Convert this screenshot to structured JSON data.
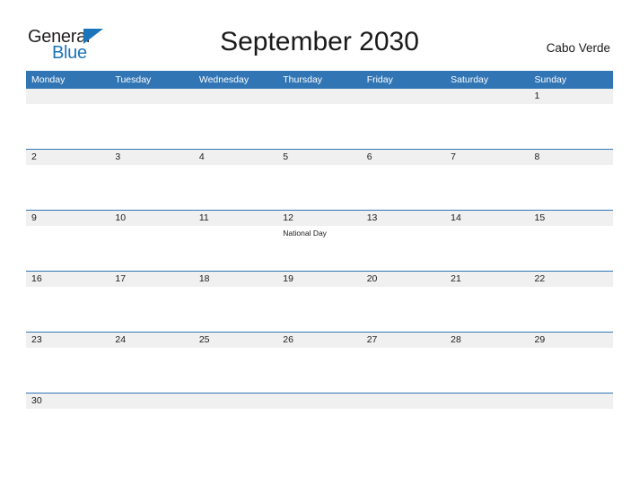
{
  "header": {
    "logo": {
      "primary_text": "General",
      "secondary_text": "Blue",
      "primary_color": "#231f20",
      "secondary_color": "#1b75bb"
    },
    "title": "September 2030",
    "country": "Cabo Verde"
  },
  "theme": {
    "header_blue": "#3175b5",
    "date_band_gray": "#f0f0f0",
    "row_rule_blue": "#3175b5",
    "text_color": "#1a1a1a"
  },
  "calendar": {
    "month": "September",
    "year": "2030",
    "weekday_headers": [
      "Monday",
      "Tuesday",
      "Wednesday",
      "Thursday",
      "Friday",
      "Saturday",
      "Sunday"
    ],
    "weeks": [
      [
        {
          "date": "",
          "events": []
        },
        {
          "date": "",
          "events": []
        },
        {
          "date": "",
          "events": []
        },
        {
          "date": "",
          "events": []
        },
        {
          "date": "",
          "events": []
        },
        {
          "date": "",
          "events": []
        },
        {
          "date": "1",
          "events": []
        }
      ],
      [
        {
          "date": "2",
          "events": []
        },
        {
          "date": "3",
          "events": []
        },
        {
          "date": "4",
          "events": []
        },
        {
          "date": "5",
          "events": []
        },
        {
          "date": "6",
          "events": []
        },
        {
          "date": "7",
          "events": []
        },
        {
          "date": "8",
          "events": []
        }
      ],
      [
        {
          "date": "9",
          "events": []
        },
        {
          "date": "10",
          "events": []
        },
        {
          "date": "11",
          "events": []
        },
        {
          "date": "12",
          "events": [
            "National Day"
          ]
        },
        {
          "date": "13",
          "events": []
        },
        {
          "date": "14",
          "events": []
        },
        {
          "date": "15",
          "events": []
        }
      ],
      [
        {
          "date": "16",
          "events": []
        },
        {
          "date": "17",
          "events": []
        },
        {
          "date": "18",
          "events": []
        },
        {
          "date": "19",
          "events": []
        },
        {
          "date": "20",
          "events": []
        },
        {
          "date": "21",
          "events": []
        },
        {
          "date": "22",
          "events": []
        }
      ],
      [
        {
          "date": "23",
          "events": []
        },
        {
          "date": "24",
          "events": []
        },
        {
          "date": "25",
          "events": []
        },
        {
          "date": "26",
          "events": []
        },
        {
          "date": "27",
          "events": []
        },
        {
          "date": "28",
          "events": []
        },
        {
          "date": "29",
          "events": []
        }
      ],
      [
        {
          "date": "30",
          "events": []
        },
        {
          "date": "",
          "events": []
        },
        {
          "date": "",
          "events": []
        },
        {
          "date": "",
          "events": []
        },
        {
          "date": "",
          "events": []
        },
        {
          "date": "",
          "events": []
        },
        {
          "date": "",
          "events": []
        }
      ]
    ]
  }
}
